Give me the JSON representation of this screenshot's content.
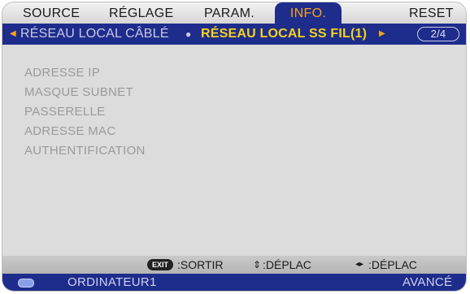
{
  "tabs": {
    "source": "SOURCE",
    "reglage": "RÉGLAGE",
    "param": "PARAM.",
    "info": "INFO.",
    "reset": "RESET"
  },
  "subtabs": {
    "wired": "RÉSEAU LOCAL CÂBLÉ",
    "wireless": "RÉSEAU LOCAL SS FIL(1)",
    "page": "2/4"
  },
  "fields": [
    "ADRESSE IP",
    "MASQUE SUBNET",
    "PASSERELLE",
    "ADRESSE MAC",
    "AUTHENTIFICATION"
  ],
  "help": {
    "exit_key": "EXIT",
    "exit_label": ":SORTIR",
    "updown_icon": "up-down-arrows-icon",
    "updown_label": ":DÉPLAC",
    "leftright_icon": "left-right-arrows-icon",
    "leftright_label": ":DÉPLAC"
  },
  "status": {
    "input_icon": "vga-connector-icon",
    "input": "ORDINATEUR1",
    "mode": "AVANCÉ"
  },
  "colors": {
    "menu_blue": "#1e2c8c",
    "active_tab_text": "#f7a51a",
    "active_subtab_text": "#f7d21a",
    "field_text": "#9a9a9a"
  }
}
